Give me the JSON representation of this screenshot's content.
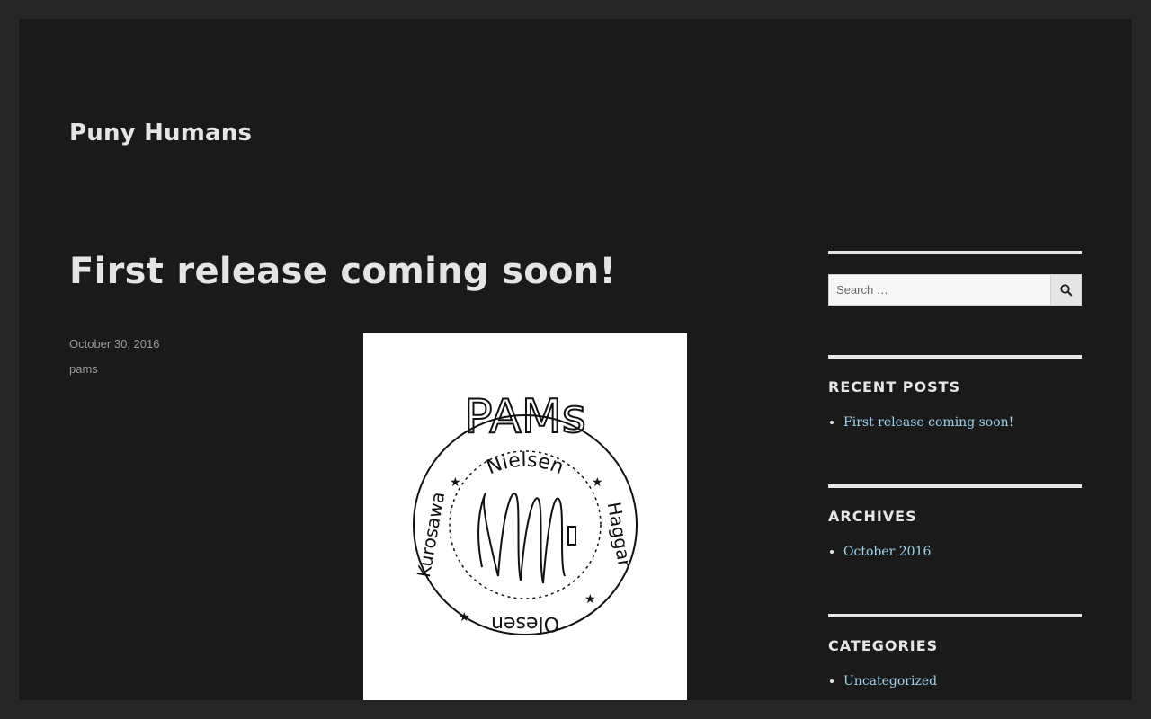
{
  "site": {
    "title": "Puny Humans"
  },
  "post": {
    "title": "First release coming soon!",
    "date": "October 30, 2016",
    "author": "pams",
    "image_text": {
      "heading": "PAMs",
      "ring_names": [
        "Nielsen",
        "Haggar",
        "Olesen",
        "Kurosawa"
      ]
    }
  },
  "sidebar": {
    "search": {
      "placeholder": "Search …",
      "button_icon": "search-icon"
    },
    "recent_posts": {
      "title": "Recent Posts",
      "items": [
        "First release coming soon!"
      ]
    },
    "archives": {
      "title": "Archives",
      "items": [
        "October 2016"
      ]
    },
    "categories": {
      "title": "Categories",
      "items": [
        "Uncategorized"
      ]
    }
  },
  "colors": {
    "page_bg": "#262626",
    "content_bg": "#1a1a1a",
    "text": "#e5e5e5",
    "meta": "#9a9a9a",
    "link": "#9ad4f2"
  }
}
